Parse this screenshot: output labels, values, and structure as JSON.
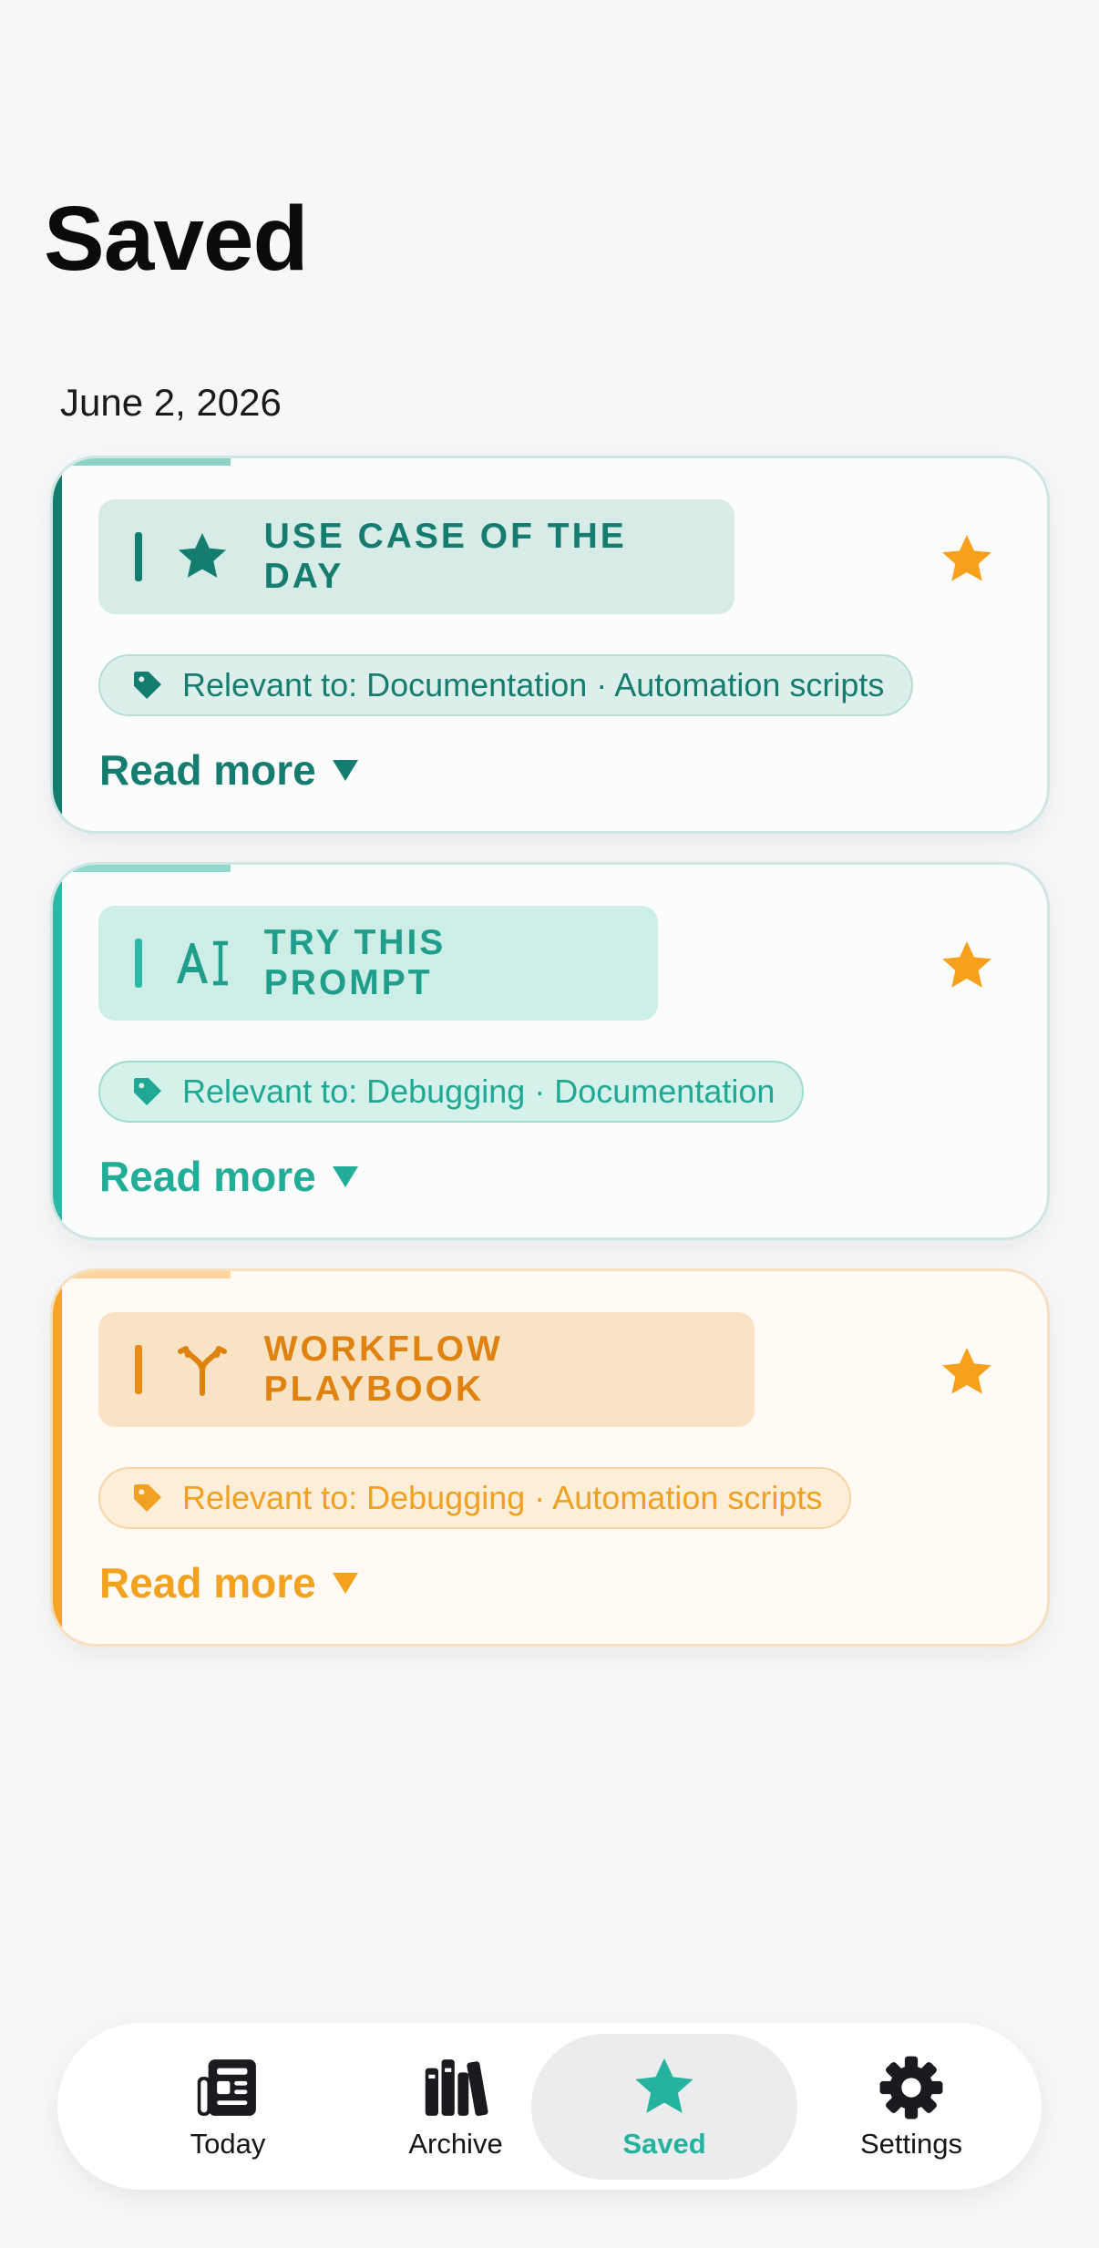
{
  "header": {
    "title": "Saved"
  },
  "section": {
    "date": "June 2, 2026"
  },
  "cards": [
    {
      "badge_label": "USE CASE OF THE DAY",
      "badge_icon": "star-icon",
      "relevance": "Relevant to: Documentation · Automation scripts",
      "read_more": "Read more",
      "accent": "#157d70",
      "saved": true
    },
    {
      "badge_label": "TRY THIS PROMPT",
      "badge_icon": "text-cursor-icon",
      "relevance": "Relevant to: Debugging · Documentation",
      "read_more": "Read more",
      "accent": "#2bb8a4",
      "saved": true
    },
    {
      "badge_label": "WORKFLOW PLAYBOOK",
      "badge_icon": "branch-icon",
      "relevance": "Relevant to: Debugging · Automation scripts",
      "read_more": "Read more",
      "accent": "#f6a623",
      "saved": true
    }
  ],
  "tabbar": {
    "items": [
      {
        "label": "Today",
        "icon": "newspaper-icon",
        "active": false
      },
      {
        "label": "Archive",
        "icon": "books-icon",
        "active": false
      },
      {
        "label": "Saved",
        "icon": "star-icon",
        "active": true
      },
      {
        "label": "Settings",
        "icon": "gear-icon",
        "active": false
      }
    ]
  },
  "colors": {
    "star": "#f6a01b",
    "active_tab": "#25b3a0"
  }
}
